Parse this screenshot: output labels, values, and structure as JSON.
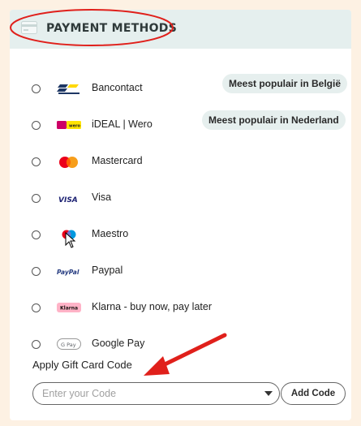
{
  "header": {
    "title": "PAYMENT METHODS",
    "icon": "credit-card-icon"
  },
  "methods": [
    {
      "label": "Bancontact",
      "icon": "bancontact-logo-icon",
      "badge": "Meest populair in België"
    },
    {
      "label": "iDEAL | Wero",
      "icon": "ideal-wero-logo-icon",
      "badge": "Meest populair in Nederland"
    },
    {
      "label": "Mastercard",
      "icon": "mastercard-logo-icon"
    },
    {
      "label": "Visa",
      "icon": "visa-logo-icon",
      "logo_text": "VISA"
    },
    {
      "label": "Maestro",
      "icon": "maestro-logo-icon"
    },
    {
      "label": "Paypal",
      "icon": "paypal-logo-icon",
      "logo_text": "PayPal"
    },
    {
      "label": "Klarna - buy now, pay later",
      "icon": "klarna-logo-icon",
      "logo_text": "Klarna"
    },
    {
      "label": "Google Pay",
      "icon": "google-pay-logo-icon",
      "logo_text": "G Pay"
    }
  ],
  "gift_card": {
    "label": "Apply Gift Card Code",
    "placeholder": "Enter your Code",
    "value": "",
    "button_label": "Add Code"
  },
  "colors": {
    "page_background": "#fdf1e3",
    "header_background": "#e5efee",
    "annotation_red": "#e0201b",
    "badge_background": "#e6efee"
  },
  "annotations": {
    "header_circled": true,
    "arrow_points_to": "gift-card-code-input"
  }
}
